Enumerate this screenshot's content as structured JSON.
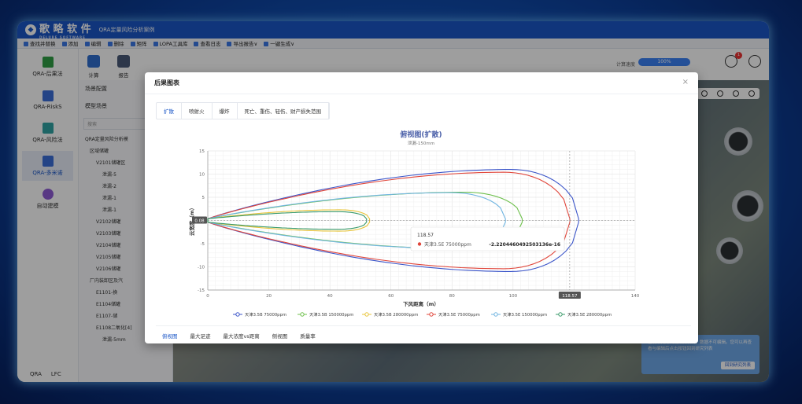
{
  "app": {
    "brand": "歌 略 软 件",
    "brand_sub": "DELURE SOFTWARE",
    "title": "QRA定量风险分析案例"
  },
  "menubar": [
    "查找并替换",
    "添加",
    "编辑",
    "删除",
    "矩阵",
    "LOPA工具库",
    "查看日志",
    "导出报告∨",
    "一键生成∨"
  ],
  "toolbar": {
    "items": [
      "计算",
      "报告"
    ],
    "zoom_label": "计算速度",
    "zoom_value": "100%",
    "badge": "1"
  },
  "leftnav": [
    {
      "label": "QRA-后果法",
      "color": "#2f9e44"
    },
    {
      "label": "QRA-RiskS",
      "color": "#3b6fd8"
    },
    {
      "label": "QRA-风险法",
      "color": "#2fa3a3"
    },
    {
      "label": "QRA-多米诺",
      "color": "#3b6fd8"
    },
    {
      "label": "自动建模",
      "color": "#8e5bd6"
    }
  ],
  "footer": {
    "qra": "QRA",
    "lfc": "LFC"
  },
  "tree": {
    "header": "场景配置",
    "sub": "模型场景",
    "search": "搜索",
    "items": [
      "QRA定量风险分析模",
      "区域储罐",
      "V2101储罐区",
      "泄漏-5",
      "泄漏-2",
      "泄漏-1",
      "泄漏-1",
      "V2102储罐",
      "V2103储罐",
      "V2104储罐",
      "V2105储罐",
      "V2106储罐",
      "厂内装卸区及汽",
      "E1101-换",
      "E1104储罐",
      "E1107-储",
      "E1108二氧化[4]",
      "泄漏-5mm"
    ]
  },
  "notice": {
    "text": "当前研究为试用案例项目，数据不可编辑。您可以再查看与编辑后点击按钮回到研究列表",
    "button": "回到研究列表"
  },
  "modal": {
    "title": "后果图表",
    "close": "×",
    "tabs": [
      "扩散",
      "喷射火",
      "爆炸",
      "死亡、重伤、轻伤、财产损失范围"
    ],
    "active_tab": 0,
    "bottom_tabs": [
      "俯视图",
      "最大足迹",
      "最大浓度vs距离",
      "侧视图",
      "质量率"
    ],
    "active_bottom": 0
  },
  "chart_data": {
    "type": "line",
    "title": "俯视图(扩散)",
    "subtitle": "泄漏-150mm",
    "xlabel": "下风距离（m）",
    "ylabel": "云宽度（m）",
    "xlim": [
      0,
      140
    ],
    "ylim": [
      -15,
      15
    ],
    "xticks": [
      0,
      20,
      40,
      60,
      80,
      100,
      120,
      140
    ],
    "yticks": [
      15,
      10,
      5,
      0,
      -5,
      -10,
      -15
    ],
    "grid": true,
    "legend_position": "bottom",
    "series": [
      {
        "name": "天津3.5B 75000ppm",
        "color": "#3b55c9",
        "xmax": 121.5,
        "halfwidth": 11.0
      },
      {
        "name": "天津3.5B 150000ppm",
        "color": "#6cbf4a",
        "xmax": 103.0,
        "halfwidth": 6.1
      },
      {
        "name": "天津3.5B 280000ppm",
        "color": "#e8c43a",
        "xmax": 53.0,
        "halfwidth": 2.3
      },
      {
        "name": "天津3.5E 75000ppm",
        "color": "#e0453a",
        "xmax": 118.6,
        "halfwidth": 10.4
      },
      {
        "name": "天津3.5E 150000ppm",
        "color": "#6fb4e0",
        "xmax": 97.5,
        "halfwidth": 6.0
      },
      {
        "name": "天津3.5E 280000ppm",
        "color": "#3a9a6a",
        "xmax": 52.0,
        "halfwidth": 1.9
      }
    ],
    "tooltip": {
      "x": "118.57",
      "series": "天津3.5E 75000ppm",
      "value": "-2.2204460492503136e-16"
    },
    "crosshair": {
      "x_label": "118.57",
      "y_label": "0.08"
    }
  }
}
